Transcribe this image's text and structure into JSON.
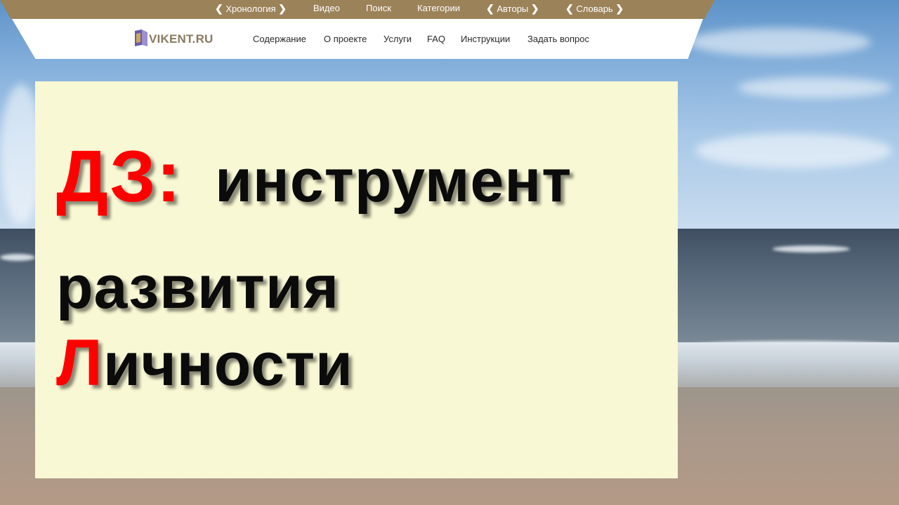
{
  "site": {
    "logo_text": "VIKENT.RU",
    "logo_icon": "book-icon"
  },
  "top_nav": {
    "items": [
      {
        "label": "Хронология",
        "chevrons": true
      },
      {
        "label": "Видео",
        "chevrons": false
      },
      {
        "label": "Поиск",
        "chevrons": false
      },
      {
        "label": "Категории",
        "chevrons": false
      },
      {
        "label": "Авторы",
        "chevrons": true
      },
      {
        "label": "Словарь",
        "chevrons": true
      }
    ],
    "chevron_left": "❮",
    "chevron_right": "❯"
  },
  "main_nav": {
    "items": [
      "Содержание",
      "О проекте",
      "Услуги",
      "FAQ",
      "Инструкции",
      "Задать вопрос"
    ]
  },
  "headline": {
    "line1_accent": "ДЗ:",
    "line1_rest": "инструмент",
    "line2": "развития",
    "line3_accent": "Л",
    "line3_rest": "ичности"
  },
  "colors": {
    "topbar": "#9b8259",
    "card": "#f9f8d4",
    "accent_red": "#ff0000",
    "text_dark": "#0b0b0b",
    "logo": "#8a7a5f"
  }
}
